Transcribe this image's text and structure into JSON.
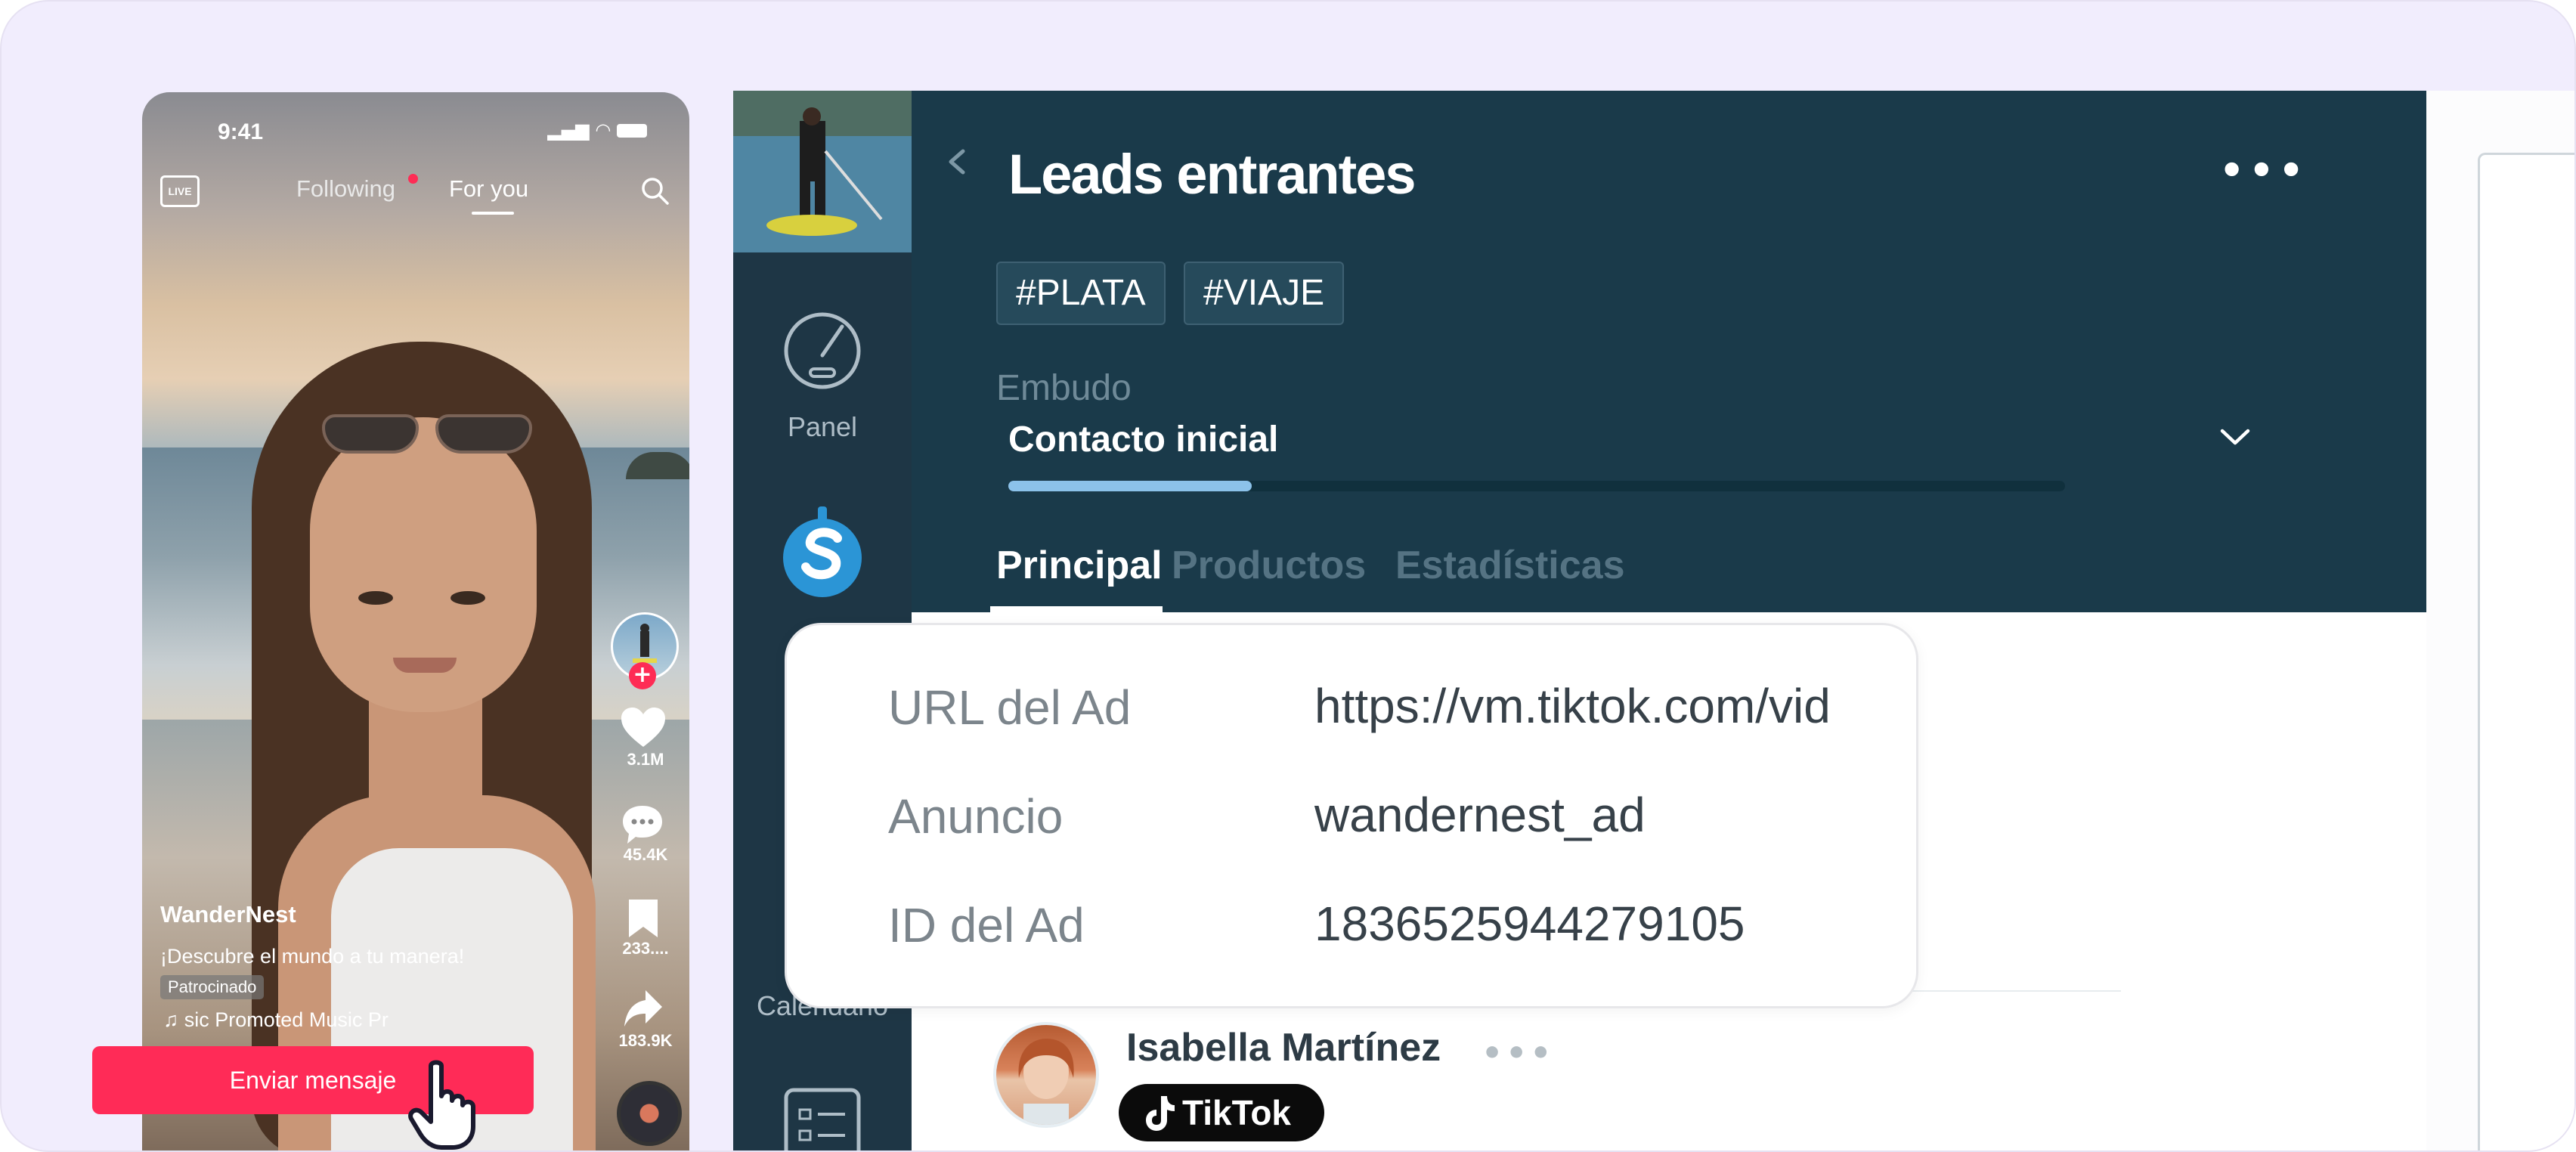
{
  "phone": {
    "time": "9:41",
    "tabs": [
      {
        "label": "Following",
        "active": false
      },
      {
        "label": "For you",
        "active": true
      }
    ],
    "live_label": "LIVE",
    "likes": "3.1M",
    "comments": "45.4K",
    "saves": "233....",
    "shares": "183.9K",
    "username": "WanderNest",
    "caption": "¡Descubre el mundo a tu manera!",
    "sponsored": "Patrocinado",
    "music_text": "sic   Promoted Music     Pr",
    "cta_label": "Enviar mensaje",
    "accent_color": "#ff2b57"
  },
  "crm": {
    "title": "Leads entrantes",
    "tags": [
      "#PLATA",
      "#VIAJE"
    ],
    "funnel": {
      "label": "Embudo",
      "value": "Contacto inicial",
      "progress_fraction": 0.23
    },
    "tabs": [
      {
        "label": "Principal",
        "active": true
      },
      {
        "label": "Productos",
        "active": false
      },
      {
        "label": "Estadísticas",
        "active": false
      }
    ],
    "sidebar": {
      "items": [
        {
          "label": "Panel",
          "icon": "speedometer-icon"
        },
        {
          "label": "Calendario",
          "icon": "calendar-icon"
        }
      ]
    },
    "contact": {
      "name": "Isabella Martínez",
      "source_label": "TikTok"
    },
    "colors": {
      "header": "#1a3a4a",
      "sidebar": "#1e3645",
      "progress": "#8cc2ea"
    }
  },
  "ad_details": {
    "rows": [
      {
        "label": "URL del Ad",
        "value": "https://vm.tiktok.com/vid"
      },
      {
        "label": "Anuncio",
        "value": "wandernest_ad"
      },
      {
        "label": "ID del Ad",
        "value": "1836525944279105"
      }
    ]
  }
}
